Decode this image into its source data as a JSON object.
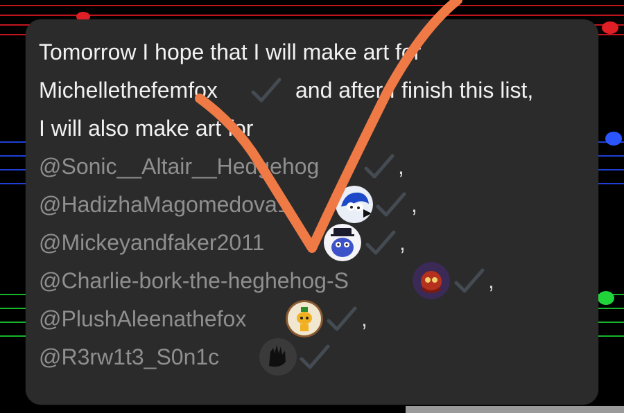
{
  "post": {
    "line1": "Tomorrow I hope that I will make art for",
    "line2_a": "Michellethefemfox",
    "line2_b": "and after I finish this list,",
    "line3": "I will also make art for",
    "mentions": [
      {
        "handle": "@Sonic__Altair__Hedgehog",
        "suffix": ","
      },
      {
        "handle": "@HadizhaMagomedova1",
        "suffix": ","
      },
      {
        "handle": "@Mickeyandfaker2011",
        "suffix": ","
      },
      {
        "handle": "@Charlie-bork-the-heghehog-S",
        "suffix": ","
      },
      {
        "handle": "@PlushAleenathefox",
        "suffix": ","
      },
      {
        "handle": "@R3rw1t3_S0n1c",
        "suffix": ""
      }
    ]
  },
  "colors": {
    "card": "#2b2b2b",
    "text": "#f2f2f2",
    "mention": "#8f8f8f",
    "checkmark": "#444a50",
    "annotation": "#ef7a45"
  },
  "icons": [
    "verified-check-icon",
    "avatar",
    "hand-drawn-checkmark"
  ]
}
